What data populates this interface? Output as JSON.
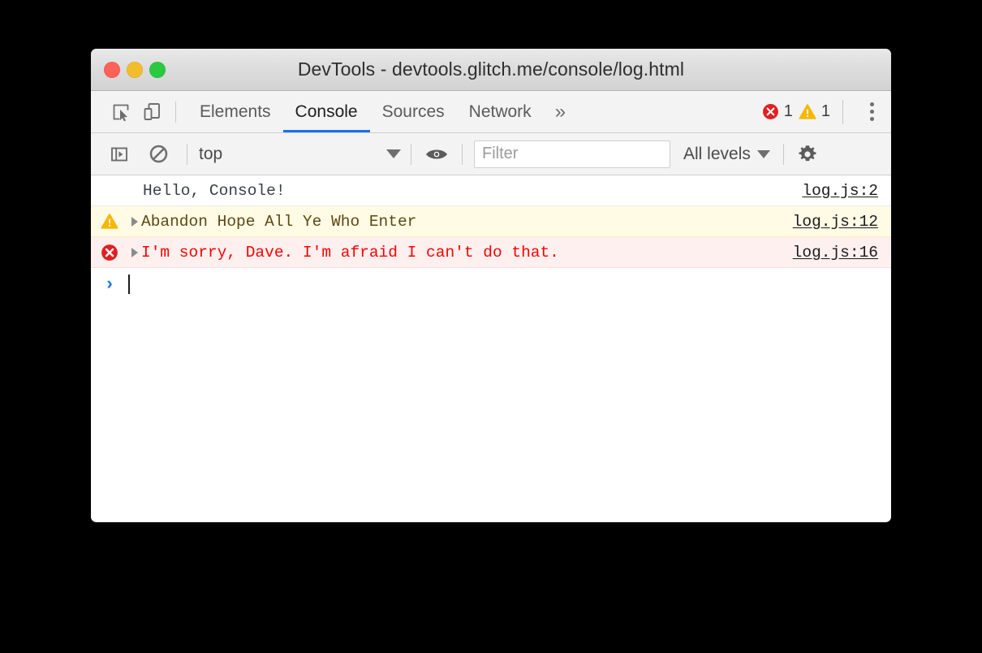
{
  "window": {
    "title": "DevTools - devtools.glitch.me/console/log.html",
    "traffic_lights": [
      {
        "name": "close",
        "color": "#ff6058"
      },
      {
        "name": "minimize",
        "color": "#f2bc2d"
      },
      {
        "name": "zoom",
        "color": "#2ac93f"
      }
    ]
  },
  "tabbar": {
    "inspect_icon": "inspect-element-icon",
    "device_icon": "device-toolbar-icon",
    "tabs": [
      {
        "label": "Elements",
        "active": false
      },
      {
        "label": "Console",
        "active": true
      },
      {
        "label": "Sources",
        "active": false
      },
      {
        "label": "Network",
        "active": false
      }
    ],
    "more_tabs_label": "»",
    "error_count": "1",
    "warning_count": "1",
    "menu_icon": "kebab-menu-icon",
    "active_tab_color": "#1a73e8"
  },
  "console_toolbar": {
    "sidebar_toggle_icon": "console-sidebar-icon",
    "clear_icon": "clear-console-icon",
    "context": "top",
    "eye_icon": "live-expression-eye-icon",
    "filter_placeholder": "Filter",
    "filter_value": "",
    "level": "All levels",
    "settings_icon": "gear-icon"
  },
  "console_messages": [
    {
      "type": "log",
      "icon": "",
      "expandable": false,
      "text": "Hello, Console!",
      "source": "log.js:2"
    },
    {
      "type": "warning",
      "icon": "warning-triangle-icon",
      "expandable": true,
      "text": "Abandon Hope All Ye Who Enter",
      "source": "log.js:12"
    },
    {
      "type": "error",
      "icon": "error-circle-icon",
      "expandable": true,
      "text": "I'm sorry, Dave. I'm afraid I can't do that.",
      "source": "log.js:16"
    }
  ],
  "prompt": {
    "arrow": "›",
    "value": ""
  },
  "colors": {
    "accent": "#1a73e8",
    "error": "#ff0000",
    "error_bg": "#fff0f0",
    "warning_text": "#5c4813",
    "warning_bg": "#fffbe5",
    "toolbar_bg": "#f3f3f3"
  }
}
